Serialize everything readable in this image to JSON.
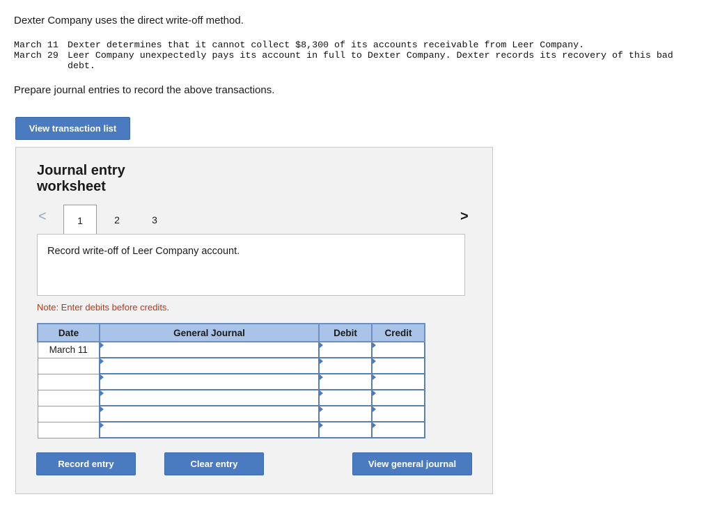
{
  "intro": "Dexter Company uses the direct write-off method.",
  "transactions": [
    {
      "date": "March 11",
      "text": "Dexter determines that it cannot collect $8,300 of its accounts receivable from Leer Company."
    },
    {
      "date": "March 29",
      "text": "Leer Company unexpectedly pays its account in full to Dexter Company. Dexter records its recovery of this bad debt."
    }
  ],
  "prompt": "Prepare journal entries to record the above transactions.",
  "buttons": {
    "view_transaction_list": "View transaction list",
    "record_entry": "Record entry",
    "clear_entry": "Clear entry",
    "view_general_journal": "View general journal"
  },
  "worksheet": {
    "title": "Journal entry worksheet",
    "nav_prev": "<",
    "nav_next": ">",
    "tabs": [
      "1",
      "2",
      "3"
    ],
    "active_tab": "1",
    "description": "Record write-off of Leer Company account.",
    "note": "Note: Enter debits before credits."
  },
  "journal_table": {
    "headers": {
      "date": "Date",
      "account": "General Journal",
      "debit": "Debit",
      "credit": "Credit"
    },
    "rows": [
      {
        "date": "March 11",
        "account": "",
        "debit": "",
        "credit": ""
      },
      {
        "date": "",
        "account": "",
        "debit": "",
        "credit": ""
      },
      {
        "date": "",
        "account": "",
        "debit": "",
        "credit": ""
      },
      {
        "date": "",
        "account": "",
        "debit": "",
        "credit": ""
      },
      {
        "date": "",
        "account": "",
        "debit": "",
        "credit": ""
      },
      {
        "date": "",
        "account": "",
        "debit": "",
        "credit": ""
      }
    ]
  },
  "colors": {
    "button_blue": "#4a7bc0",
    "header_blue": "#a9c4e8",
    "note_red": "#b03a1a",
    "panel_gray": "#f2f2f2"
  }
}
